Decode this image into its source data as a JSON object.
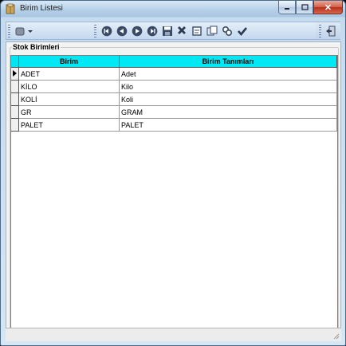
{
  "window": {
    "title": "Birim Listesi",
    "close_glyph": "✕"
  },
  "toolbar": {
    "icons": [
      "dropdown-icon",
      "first-record-icon",
      "prior-record-icon",
      "next-record-icon",
      "last-record-icon",
      "save-icon",
      "delete-icon",
      "edit-icon",
      "refresh-icon",
      "filter-icon",
      "post-icon",
      "exit-icon"
    ]
  },
  "group": {
    "title": "Stok Birimleri"
  },
  "grid": {
    "columns": [
      "Birim",
      "Birim Tanımları"
    ],
    "rows": [
      [
        "ADET",
        "Adet"
      ],
      [
        "KİLO",
        "Kilo"
      ],
      [
        "KOLİ",
        "Koli"
      ],
      [
        "GR",
        "GRAM"
      ],
      [
        "PALET",
        "PALET"
      ]
    ],
    "selected_row": 0
  },
  "colors": {
    "header": "#00e8f4",
    "window": "#b9d3ea"
  }
}
